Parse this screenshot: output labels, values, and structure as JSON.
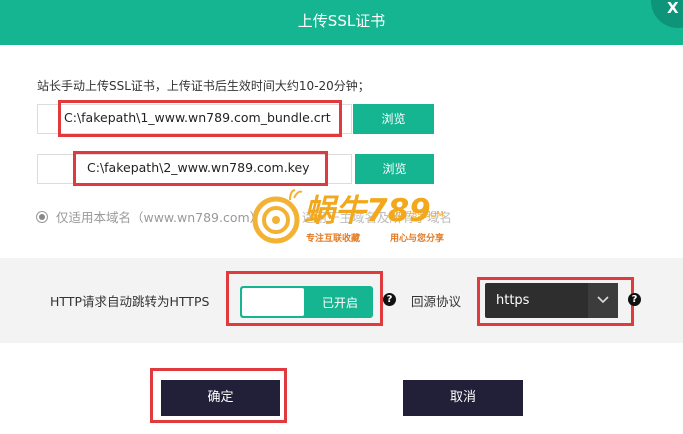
{
  "dialog": {
    "title": "上传SSL证书",
    "close_label": "X",
    "intro": "站长手动上传SSL证书，上传证书后生效时间大约10-20分钟；"
  },
  "upload": {
    "cert_file": "C:\\fakepath\\1_www.wn789.com_bundle.crt",
    "key_file": "C:\\fakepath\\2_www.wn789.com.key",
    "browse_label": "浏览"
  },
  "scope": {
    "option_text": "仅适用本域名（www.wn789.com）",
    "obscured_text": "适用于主域名及所有子域名"
  },
  "settings": {
    "http_redirect_label": "HTTP请求自动跳转为HTTPS",
    "toggle_state": "已开启",
    "help_glyph": "?",
    "protocol_label": "回源协议",
    "protocol_value": "https"
  },
  "actions": {
    "confirm": "确定",
    "cancel": "取消"
  },
  "watermark": {
    "brand": "蜗牛789",
    "site": "WN789.COM",
    "tagline_1": "专注互联收藏",
    "tagline_2": "用心与您分享"
  },
  "colors": {
    "accent": "#16b592",
    "highlight": "#e0393e",
    "button_dark": "#222038"
  }
}
